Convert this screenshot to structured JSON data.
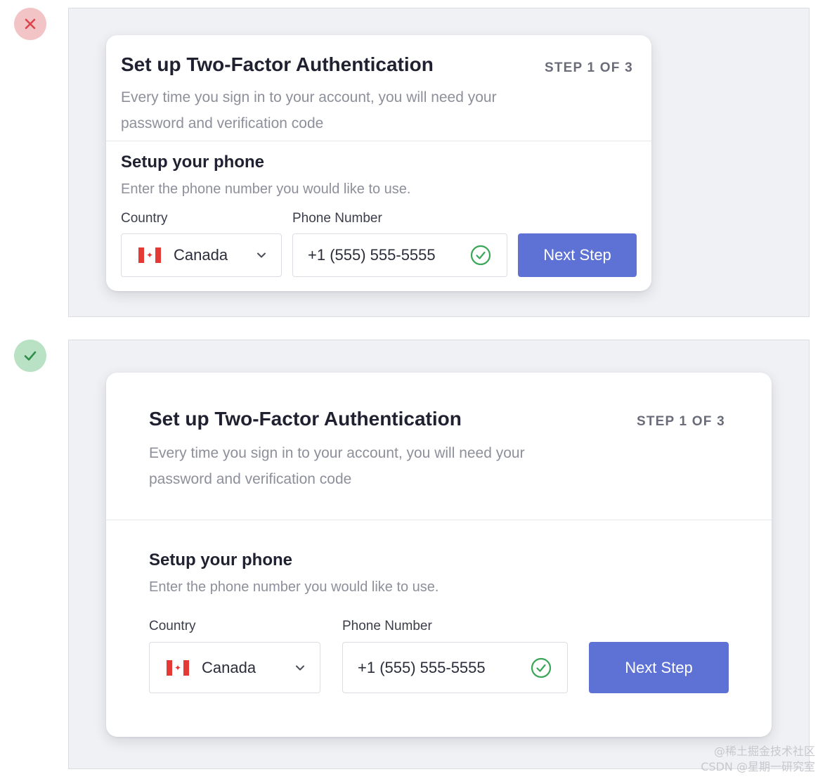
{
  "markers": {
    "bad": "close-icon",
    "good": "check-icon"
  },
  "colors": {
    "accent": "#5e72d6",
    "bad_marker": "#f2c4c6",
    "good_marker": "#b9e2c4",
    "valid": "#3aa657"
  },
  "examples": [
    {
      "title": "Set up Two-Factor Authentication",
      "step": "STEP 1 OF 3",
      "description": "Every time you sign in to your account, you will need your password and verification code",
      "section_title": "Setup your phone",
      "section_subtitle": "Enter the phone number you would like to use.",
      "country_label": "Country",
      "country_value": "Canada",
      "country_flag": "canada-flag-icon",
      "phone_label": "Phone Number",
      "phone_value": "+1 (555) 555-5555",
      "button_label": "Next Step"
    },
    {
      "title": "Set up Two-Factor Authentication",
      "step": "STEP 1 OF 3",
      "description": "Every time you sign in to your account, you will need your password and verification code",
      "section_title": "Setup your phone",
      "section_subtitle": "Enter the phone number you would like to use.",
      "country_label": "Country",
      "country_value": "Canada",
      "country_flag": "canada-flag-icon",
      "phone_label": "Phone Number",
      "phone_value": "+1 (555) 555-5555",
      "button_label": "Next Step"
    }
  ],
  "watermark": {
    "line1": "@稀土掘金技术社区",
    "line2": "CSDN @星期一研究室"
  }
}
